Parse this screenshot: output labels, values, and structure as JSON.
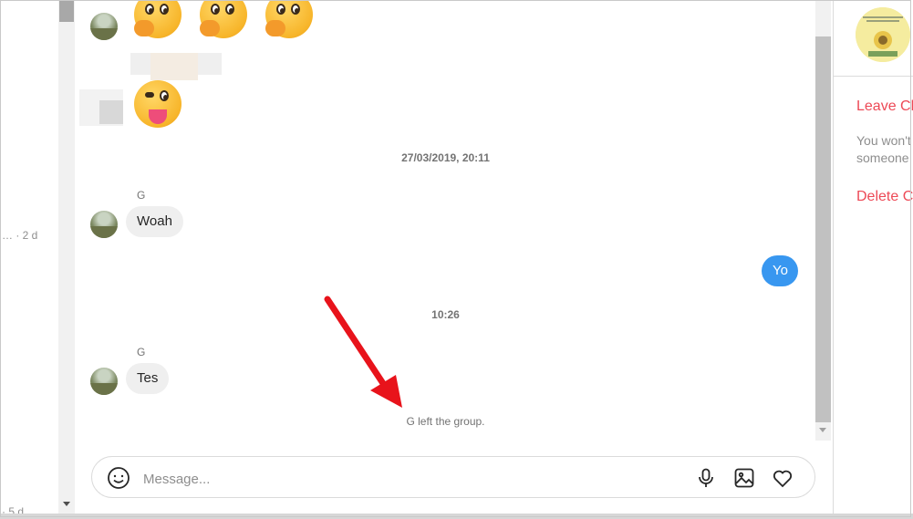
{
  "thread_list": {
    "items": [
      {
        "meta": "… · 2 d"
      },
      {
        "meta": "· 5 d"
      }
    ]
  },
  "chat": {
    "messages": [
      {
        "type": "timestamp",
        "text": "27/03/2019, 20:11"
      },
      {
        "type": "incoming",
        "sender": "G",
        "text": "Woah"
      },
      {
        "type": "outgoing",
        "text": "Yo"
      },
      {
        "type": "timestamp",
        "text": "10:26"
      },
      {
        "type": "incoming",
        "sender": "G",
        "text": "Tes"
      },
      {
        "type": "system",
        "text": "G left the group."
      }
    ]
  },
  "composer": {
    "placeholder": "Message...",
    "value": "",
    "icons": [
      "emoji-icon",
      "microphone-icon",
      "image-icon",
      "heart-icon"
    ]
  },
  "details": {
    "leave_chat_label": "Leave Ch",
    "note_line1": "You won't",
    "note_line2": "someone",
    "delete_chat_label": "Delete C"
  },
  "colors": {
    "accent_blue": "#3897f0",
    "danger_red": "#ed4956",
    "annotation_arrow": "#e8131b"
  }
}
